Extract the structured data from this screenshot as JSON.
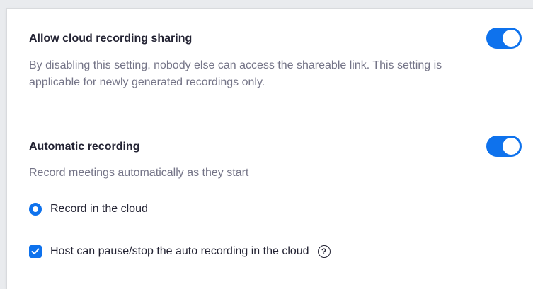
{
  "cloud_sharing": {
    "title": "Allow cloud recording sharing",
    "description": "By disabling this setting, nobody else can access the shareable link. This setting is applicable for newly generated recordings only.",
    "enabled": true
  },
  "automatic_recording": {
    "title": "Automatic recording",
    "description": "Record meetings automatically as they start",
    "enabled": true,
    "radio_option": {
      "label": "Record in the cloud",
      "selected": true
    },
    "checkbox_option": {
      "label": "Host can pause/stop the auto recording in the cloud",
      "checked": true,
      "help_glyph": "?"
    }
  },
  "colors": {
    "accent": "#0e72ed",
    "title_text": "#232333",
    "description_text": "#747487",
    "background": "#ffffff"
  },
  "icons": {
    "toggle": "toggle-switch",
    "radio": "radio-button-selected",
    "checkbox": "checkmark-icon",
    "help": "question-circle-icon"
  }
}
